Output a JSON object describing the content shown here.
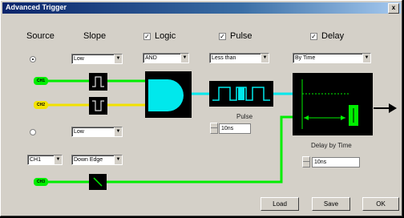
{
  "window": {
    "title": "Advanced Trigger",
    "close_glyph": "x"
  },
  "headers": {
    "source": "Source",
    "slope": "Slope",
    "logic": "Logic",
    "pulse": "Pulse",
    "delay": "Delay"
  },
  "checkboxes": {
    "logic_checked": true,
    "pulse_checked": true,
    "delay_checked": true,
    "check_glyph": "✓"
  },
  "dropdowns": {
    "slope_top": "Low",
    "logic": "AND",
    "pulse": "Less than",
    "delay": "By Time",
    "slope_bottom": "Low",
    "channel": "CH1",
    "edge": "Down Edge"
  },
  "chips": {
    "ch_a": "CH1",
    "ch_b": "CH2",
    "ch_c": "CH3"
  },
  "pulse_section": {
    "label": "Pulse",
    "value": "10ns"
  },
  "delay_section": {
    "label": "Delay by Time",
    "value": "10ns"
  },
  "buttons": {
    "load": "Load",
    "save": "Save",
    "ok": "OK"
  },
  "colors": {
    "green": "#00ee00",
    "yellow": "#f2e200",
    "cyan": "#00e8ec",
    "panel": "#d4d0c8"
  }
}
